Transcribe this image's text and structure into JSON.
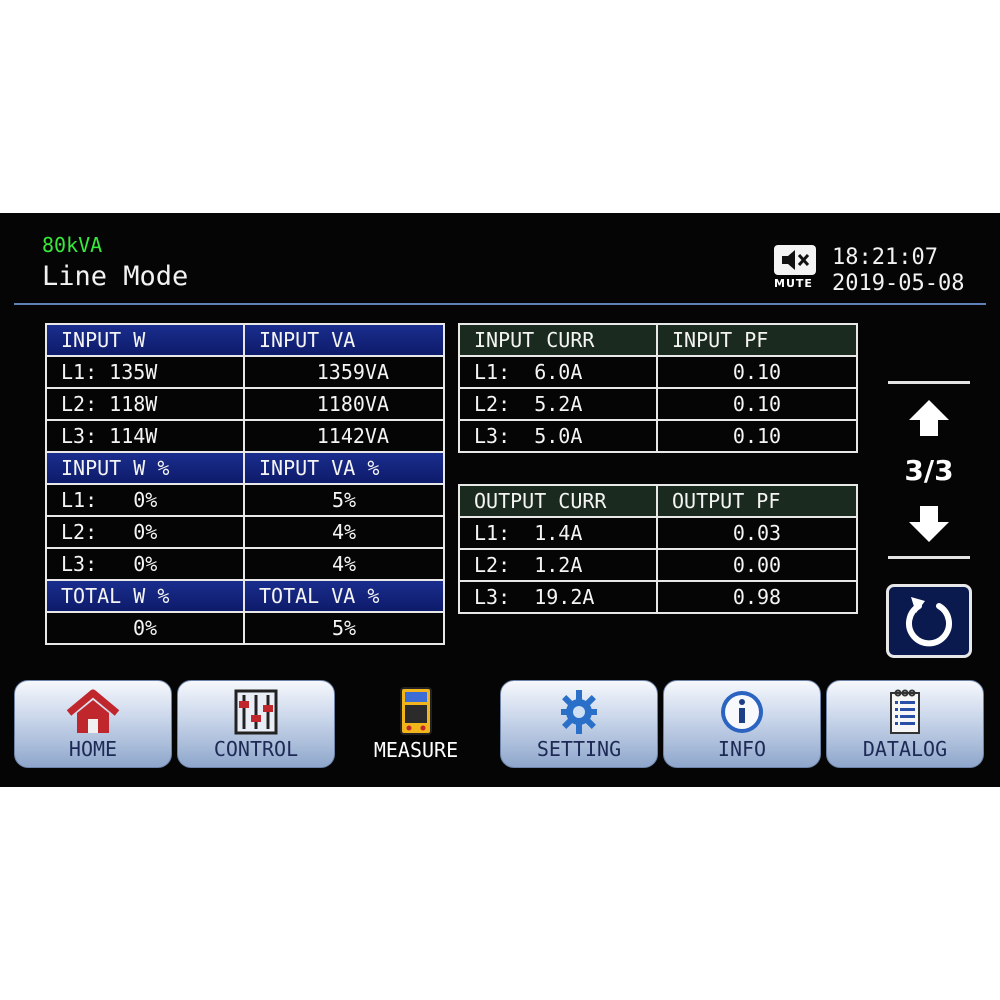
{
  "header": {
    "model": "80kVA",
    "mode": "Line Mode",
    "mute_label": "MUTE",
    "time": "18:21:07",
    "date": "2019-05-08"
  },
  "left_table": {
    "h1": [
      "INPUT W",
      "INPUT VA"
    ],
    "rows1": [
      [
        "L1: 135W",
        "1359VA"
      ],
      [
        "L2: 118W",
        "1180VA"
      ],
      [
        "L3: 114W",
        "1142VA"
      ]
    ],
    "h2": [
      "INPUT W %",
      "INPUT VA %"
    ],
    "rows2": [
      [
        "L1:   0%",
        "5%"
      ],
      [
        "L2:   0%",
        "4%"
      ],
      [
        "L3:   0%",
        "4%"
      ]
    ],
    "h3": [
      "TOTAL W %",
      "TOTAL VA %"
    ],
    "rows3": [
      [
        "0%",
        "5%"
      ]
    ]
  },
  "input_table": {
    "headers": [
      "INPUT CURR",
      "INPUT PF"
    ],
    "rows": [
      [
        "L1:  6.0A",
        "0.10"
      ],
      [
        "L2:  5.2A",
        "0.10"
      ],
      [
        "L3:  5.0A",
        "0.10"
      ]
    ]
  },
  "output_table": {
    "headers": [
      "OUTPUT CURR",
      "OUTPUT PF"
    ],
    "rows": [
      [
        "L1:  1.4A",
        "0.03"
      ],
      [
        "L2:  1.2A",
        "0.00"
      ],
      [
        "L3:  19.2A",
        "0.98"
      ]
    ]
  },
  "pager": {
    "text": "3/3"
  },
  "nav": {
    "home": "HOME",
    "control": "CONTROL",
    "measure": "MEASURE",
    "setting": "SETTING",
    "info": "INFO",
    "datalog": "DATALOG"
  },
  "colors": {
    "model_green": "#39e83c",
    "header_blue": "#1a2d8e",
    "header_dark": "#1b2a1e"
  }
}
